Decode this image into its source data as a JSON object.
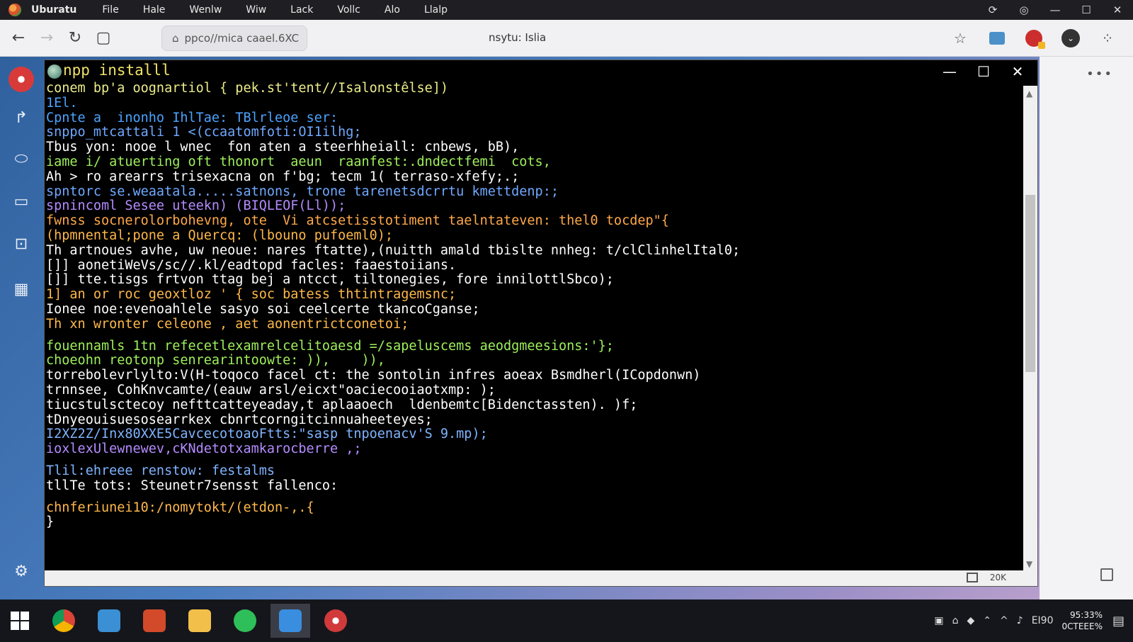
{
  "menubar": {
    "items": [
      "Uburatu",
      "File",
      "Hale",
      "Wenlw",
      "Wiw",
      "Lack",
      "Vollc",
      "Alo",
      "Llalp"
    ]
  },
  "browser": {
    "address": "ppco//mica caael.6XC",
    "page_title": "nsytu: Islia",
    "icons": [
      "back-icon",
      "forward-icon",
      "reload-icon",
      "stop-icon",
      "lock-icon",
      "star-icon",
      "extension-icon",
      "record-icon",
      "profile-icon",
      "puzzle-icon"
    ]
  },
  "terminal": {
    "title": "npp installl",
    "lines": [
      {
        "t": "conem bp'a oognartiol { pek.st'tent//Isalonstêlse])",
        "c": "#ecec8a"
      },
      {
        "t": "1El.",
        "c": "#4aa3ff"
      },
      {
        "t": "Cpnte a  inonho IhlTae: TBlrleoe ser:",
        "c": "#4aa3ff"
      },
      {
        "t": "snppo_mtcattali 1 <(ccaatomfoti:OI1ilhg;",
        "c": "#6fa8ff"
      },
      {
        "t": "Tbus yon: nooe l wnec  fon aten a steerhheiall: cnbews, bB),",
        "c": "#ffffff"
      },
      {
        "t": "iame i/ atuerting oft thonort  aeun  raanfest:.dndectfemi  cots,",
        "c": "#9ef05c"
      },
      {
        "t": "Ah > ro arearrs trisexacna on f'bg; tecm 1( terraso-xfefy;.;",
        "c": "#ffffff"
      },
      {
        "t": "spntorc se.weaatala.....satnons, trone tarenetsdcrrtu kmettdenp:;",
        "c": "#6fa8ff"
      },
      {
        "t": "spnincoml Sesee uteekn) (BIQLEOF(Ll));",
        "c": "#b48cff"
      },
      {
        "t": "fwnss socnerolorbohevng, ote  Vi atcsetisstotiment taelntateven: thel0 tocdep\"{",
        "c": "#ffa84a"
      },
      {
        "t": "(hpmnental;pone a Quercq: (lbouno pufoeml0);",
        "c": "#ffb84a"
      },
      {
        "t": "Th artnoues avhe, uw neoue: nares ftatte),(nuitth amald tbislte nnheg: t/clClinhelItal0;",
        "c": "#ffffff"
      },
      {
        "t": "[]] aonetiWeVs/sc//.kl/eadtopd facles: faaestoiians.",
        "c": "#ffffff"
      },
      {
        "t": "[]] tte.tisgs frtvon ttag bej a ntcct, tiltonegies, fore innilottlSbco);",
        "c": "#ffffff"
      },
      {
        "t": "1] an or roc geoxtloz ' { soc batess thtintragemsnc;",
        "c": "#ffb84a"
      },
      {
        "t": "Ionee noe:evenoahlele sasyo soi ceelcerte tkancoCganse;",
        "c": "#ffffff"
      },
      {
        "t": "Th xn wronter celeone , aet aonentrictconetoi;",
        "c": "#ffb84a"
      },
      {
        "gap": true
      },
      {
        "t": "fouennamls 1tn refecetlexamrelcelitoaesd =/sapeluscems aeodgmeesions:'};",
        "c": "#9ef05c"
      },
      {
        "t": "choeohn reotonp senrearintoowte: )),    )),",
        "c": "#9ef05c"
      },
      {
        "t": "torrebolevrlylto:V(H-toqoco facel ct: the sontolin infres aoeax Bsmdherl(ICopdonwn)",
        "c": "#ffffff"
      },
      {
        "t": "trnnsee, CohKnvcamte/(eauw arsl/eicxt\"oaciecooiaotxmp: );",
        "c": "#ffffff"
      },
      {
        "t": "tiucstulsctecoy nefttcatteyeaday,t aplaaoech  ldenbemtc[Bidenctassten). )f;",
        "c": "#ffffff"
      },
      {
        "t": "tDnyeouisuesosearrkex cbnrtcorngitcinnuaheeteyes;",
        "c": "#ffffff"
      },
      {
        "t": "I2XZ2Z/Inx80XXE5CavcecotoaoFtts:\"sasp tnpoenacv'S 9.mp);",
        "c": "#7fb4ff"
      },
      {
        "t": "ioxlexUlewnewev,cKNdetotxamkarocberre ,;",
        "c": "#b48cff"
      },
      {
        "gap": true
      },
      {
        "t": "Tlil:ehreee renstow: festalms",
        "c": "#7fb4ff"
      },
      {
        "t": "tllTe tots: Steunetr7sensst fallenco:",
        "c": "#ffffff"
      },
      {
        "gap": true
      },
      {
        "t": "chnferiunei10:/nomytokt/(etdon-,.{",
        "c": "#ffb84a"
      },
      {
        "t": "}",
        "c": "#ffffff"
      }
    ],
    "zoom": "20K"
  },
  "taskbar": {
    "apps": [
      "start-icon",
      "chrome-icon",
      "files-icon",
      "office-icon",
      "folder-icon",
      "spotify-icon",
      "editor-icon",
      "media-icon"
    ],
    "clock_time": "95:33%",
    "clock_date": "0CTEEE%",
    "tray_text": "EI90"
  }
}
